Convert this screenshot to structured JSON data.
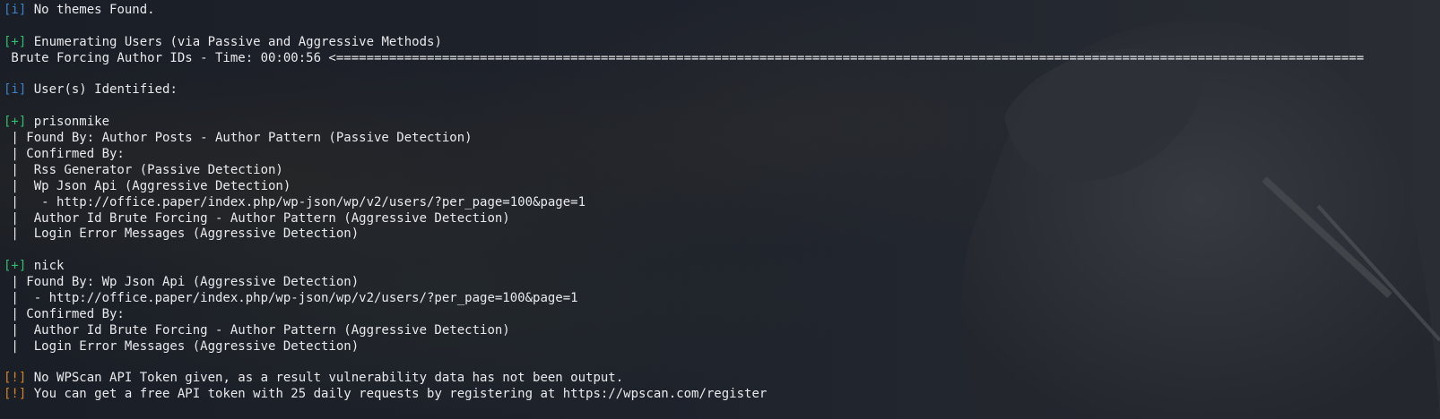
{
  "terminal": {
    "lines": [
      {
        "tag": "[i]",
        "tag_type": "info",
        "text": " No themes Found."
      },
      {
        "tag": "",
        "tag_type": "",
        "text": ""
      },
      {
        "tag": "[+]",
        "tag_type": "plus",
        "text": " Enumerating Users (via Passive and Aggressive Methods)"
      },
      {
        "tag": "",
        "tag_type": "",
        "text": " Brute Forcing Author IDs - Time: 00:00:56 <========================================================================================================================================"
      },
      {
        "tag": "",
        "tag_type": "",
        "text": ""
      },
      {
        "tag": "[i]",
        "tag_type": "info",
        "text": " User(s) Identified:"
      },
      {
        "tag": "",
        "tag_type": "",
        "text": ""
      },
      {
        "tag": "[+]",
        "tag_type": "plus",
        "text": " prisonmike"
      },
      {
        "tag": "",
        "tag_type": "",
        "text": " | Found By: Author Posts - Author Pattern (Passive Detection)"
      },
      {
        "tag": "",
        "tag_type": "",
        "text": " | Confirmed By:"
      },
      {
        "tag": "",
        "tag_type": "",
        "text": " |  Rss Generator (Passive Detection)"
      },
      {
        "tag": "",
        "tag_type": "",
        "text": " |  Wp Json Api (Aggressive Detection)"
      },
      {
        "tag": "",
        "tag_type": "",
        "text": " |   - http://office.paper/index.php/wp-json/wp/v2/users/?per_page=100&page=1"
      },
      {
        "tag": "",
        "tag_type": "",
        "text": " |  Author Id Brute Forcing - Author Pattern (Aggressive Detection)"
      },
      {
        "tag": "",
        "tag_type": "",
        "text": " |  Login Error Messages (Aggressive Detection)"
      },
      {
        "tag": "",
        "tag_type": "",
        "text": ""
      },
      {
        "tag": "[+]",
        "tag_type": "plus",
        "text": " nick"
      },
      {
        "tag": "",
        "tag_type": "",
        "text": " | Found By: Wp Json Api (Aggressive Detection)"
      },
      {
        "tag": "",
        "tag_type": "",
        "text": " |  - http://office.paper/index.php/wp-json/wp/v2/users/?per_page=100&page=1"
      },
      {
        "tag": "",
        "tag_type": "",
        "text": " | Confirmed By:"
      },
      {
        "tag": "",
        "tag_type": "",
        "text": " |  Author Id Brute Forcing - Author Pattern (Aggressive Detection)"
      },
      {
        "tag": "",
        "tag_type": "",
        "text": " |  Login Error Messages (Aggressive Detection)"
      },
      {
        "tag": "",
        "tag_type": "",
        "text": ""
      },
      {
        "tag": "[!]",
        "tag_type": "warn",
        "text": " No WPScan API Token given, as a result vulnerability data has not been output."
      },
      {
        "tag": "[!]",
        "tag_type": "warn",
        "text": " You can get a free API token with 25 daily requests by registering at https://wpscan.com/register"
      }
    ]
  },
  "colors": {
    "info": "#3b82c8",
    "plus": "#2fbf71",
    "warn": "#d7812b",
    "text": "#e8eaed",
    "background": "#1b1f27"
  }
}
